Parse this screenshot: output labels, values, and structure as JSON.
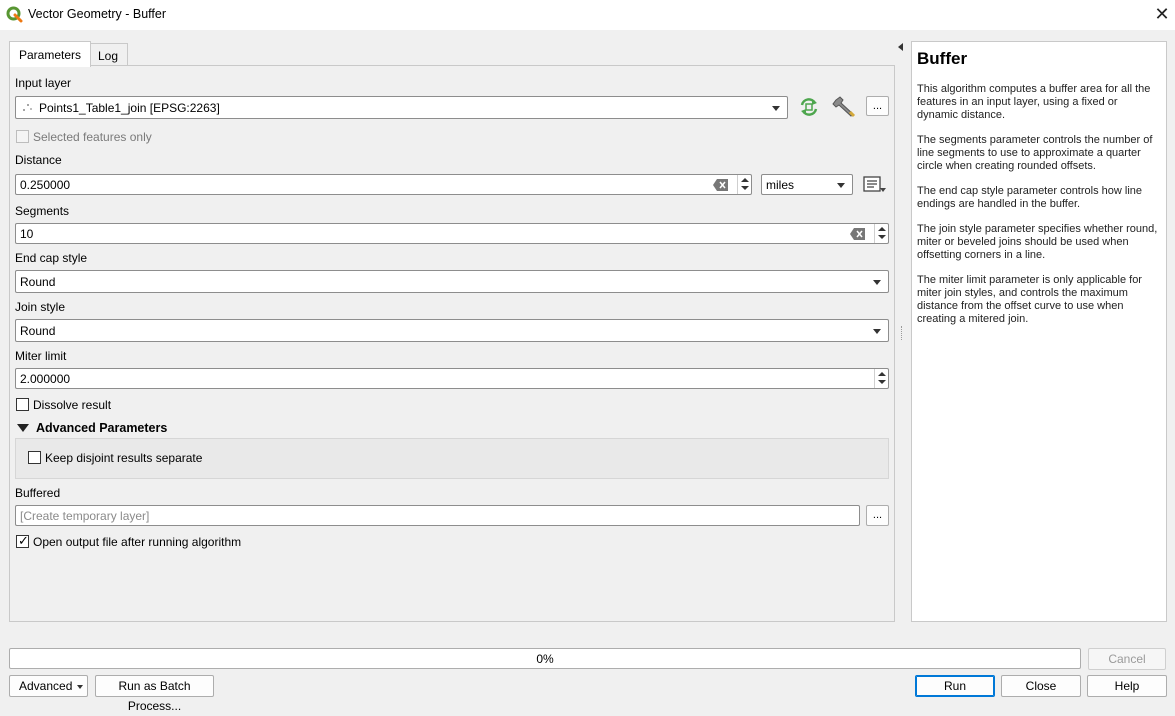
{
  "window": {
    "title": "Vector Geometry - Buffer",
    "close_glyph": "✕"
  },
  "tabs": [
    {
      "label": "Parameters",
      "active": true
    },
    {
      "label": "Log",
      "active": false
    }
  ],
  "params": {
    "input_layer": {
      "label": "Input layer",
      "value": "Points1_Table1_join [EPSG:2263]"
    },
    "selected_only": {
      "label": "Selected features only",
      "checked": false,
      "enabled": false
    },
    "distance": {
      "label": "Distance",
      "value": "0.250000",
      "unit": "miles"
    },
    "segments": {
      "label": "Segments",
      "value": "10"
    },
    "end_cap": {
      "label": "End cap style",
      "value": "Round"
    },
    "join_style": {
      "label": "Join style",
      "value": "Round"
    },
    "miter_limit": {
      "label": "Miter limit",
      "value": "2.000000"
    },
    "dissolve": {
      "label": "Dissolve result",
      "checked": false
    },
    "advanced": {
      "label": "Advanced Parameters",
      "expanded": true,
      "keep_disjoint": {
        "label": "Keep disjoint results separate",
        "checked": false
      }
    },
    "buffered": {
      "label": "Buffered",
      "placeholder": "[Create temporary layer]"
    },
    "open_output": {
      "label": "Open output file after running algorithm",
      "checked": true
    },
    "browse_label": "..."
  },
  "help": {
    "title": "Buffer",
    "paragraphs": [
      "This algorithm computes a buffer area for all the features in an input layer, using a fixed or dynamic distance.",
      "The segments parameter controls the number of line segments to use to approximate a quarter circle when creating rounded offsets.",
      "The end cap style parameter controls how line endings are handled in the buffer.",
      "The join style parameter specifies whether round, miter or beveled joins should be used when offsetting corners in a line.",
      "The miter limit parameter is only applicable for miter join styles, and controls the maximum distance from the offset curve to use when creating a mitered join."
    ]
  },
  "footer": {
    "progress_text": "0%",
    "progress_value": 0,
    "cancel": "Cancel",
    "advanced": "Advanced",
    "batch": "Run as Batch Process...",
    "run": "Run",
    "close": "Close",
    "help": "Help"
  },
  "colors": {
    "qgis_green": "#589632",
    "accent": "#0078d7"
  }
}
